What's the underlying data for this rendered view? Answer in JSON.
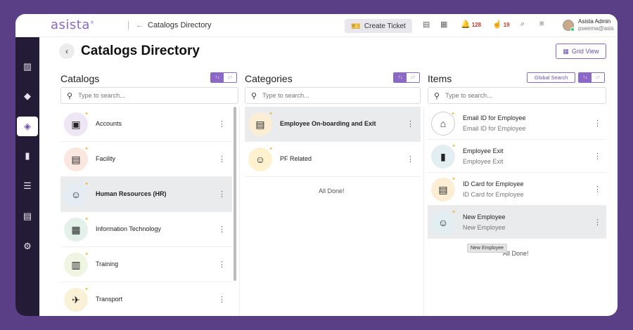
{
  "app": {
    "logo": "asista",
    "logo_mark": "®"
  },
  "header": {
    "breadcrumb": "Catalogs Directory",
    "create_ticket": "Create Ticket",
    "notifications_count": "128",
    "tasks_count": "19",
    "user_name": "Asista Admin",
    "user_email": "pseema@asis"
  },
  "page": {
    "title": "Catalogs Directory",
    "grid_view": "Grid View"
  },
  "columns": {
    "catalogs": {
      "title": "Catalogs",
      "search_placeholder": "Type to search...",
      "items": [
        {
          "label": "Accounts",
          "icon": "accounts-icon",
          "thumb_color": "#efe6f5",
          "glyph": "▣"
        },
        {
          "label": "Facility",
          "icon": "facility-icon",
          "thumb_color": "#fbe7e0",
          "glyph": "▤"
        },
        {
          "label": "Human Resources (HR)",
          "icon": "hr-icon",
          "thumb_color": "#e6ecf3",
          "glyph": "☺",
          "selected": true
        },
        {
          "label": "Information Technology",
          "icon": "it-icon",
          "thumb_color": "#e3f1ea",
          "glyph": "▦"
        },
        {
          "label": "Training",
          "icon": "training-icon",
          "thumb_color": "#eef5e2",
          "glyph": "▥"
        },
        {
          "label": "Transport",
          "icon": "transport-icon",
          "thumb_color": "#fbf1d7",
          "glyph": "✈"
        }
      ]
    },
    "categories": {
      "title": "Categories",
      "search_placeholder": "Type to search...",
      "items": [
        {
          "label": "Employee On-boarding and Exit",
          "icon": "id-badge-icon",
          "thumb_color": "#fbeed5",
          "glyph": "▤",
          "selected": true
        },
        {
          "label": "PF Related",
          "icon": "pf-icon",
          "thumb_color": "#fdf1cf",
          "glyph": "☺"
        }
      ],
      "done": "All Done!"
    },
    "items": {
      "title": "Items",
      "global_search": "Global Search",
      "search_placeholder": "Type to search...",
      "items": [
        {
          "title": "Email ID for Employee",
          "subtitle": "Email ID for Employee",
          "icon": "tag-icon",
          "thumb_color": "#ffffff",
          "glyph": "⌂"
        },
        {
          "title": "Employee Exit",
          "subtitle": "Employee Exit",
          "icon": "exit-door-icon",
          "thumb_color": "#e3eef2",
          "glyph": "▮"
        },
        {
          "title": "ID Card for Employee",
          "subtitle": "ID Card for Employee",
          "icon": "id-card-icon",
          "thumb_color": "#fbeed5",
          "glyph": "▤"
        },
        {
          "title": "New Employee",
          "subtitle": "New Employee",
          "icon": "new-employee-icon",
          "thumb_color": "#e3eef2",
          "glyph": "☺",
          "selected": true
        }
      ],
      "done": "All Done!",
      "tooltip": "New Employee"
    }
  },
  "colors": {
    "accent": "#8b68c6",
    "sidebar": "#241b36",
    "frame_bg": "#5a3e86",
    "selected_row": "#e9ebec"
  }
}
